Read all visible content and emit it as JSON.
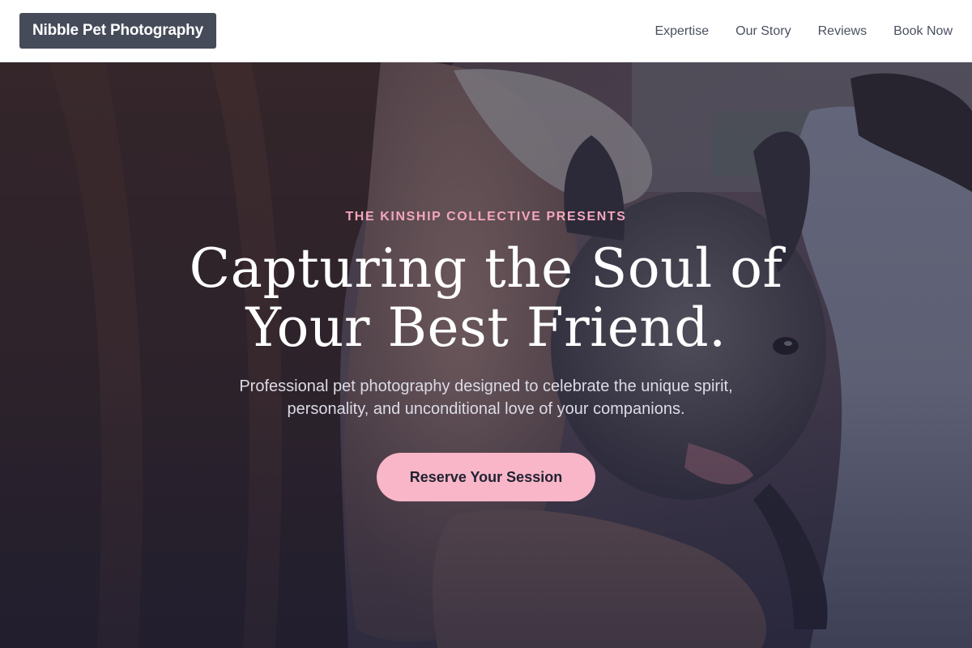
{
  "header": {
    "brand": "Nibble Pet Photography",
    "nav": [
      {
        "label": "Expertise"
      },
      {
        "label": "Our Story"
      },
      {
        "label": "Reviews"
      },
      {
        "label": "Book Now"
      }
    ]
  },
  "hero": {
    "eyebrow": "THE KINSHIP COLLECTIVE PRESENTS",
    "headline_line1": "Capturing the Soul of",
    "headline_line2": "Your Best Friend.",
    "subtext_line1": "Professional pet photography designed to celebrate the unique spirit,",
    "subtext_line2": "personality, and unconditional love of your companions.",
    "cta_label": "Reserve Your Session"
  },
  "colors": {
    "header_bg": "#ffffff",
    "brand_bg": "#454b59",
    "nav_text": "#4b5160",
    "eyebrow": "#f4a6bd",
    "cta_bg": "#f8b6c8",
    "cta_text": "#1f2230"
  }
}
